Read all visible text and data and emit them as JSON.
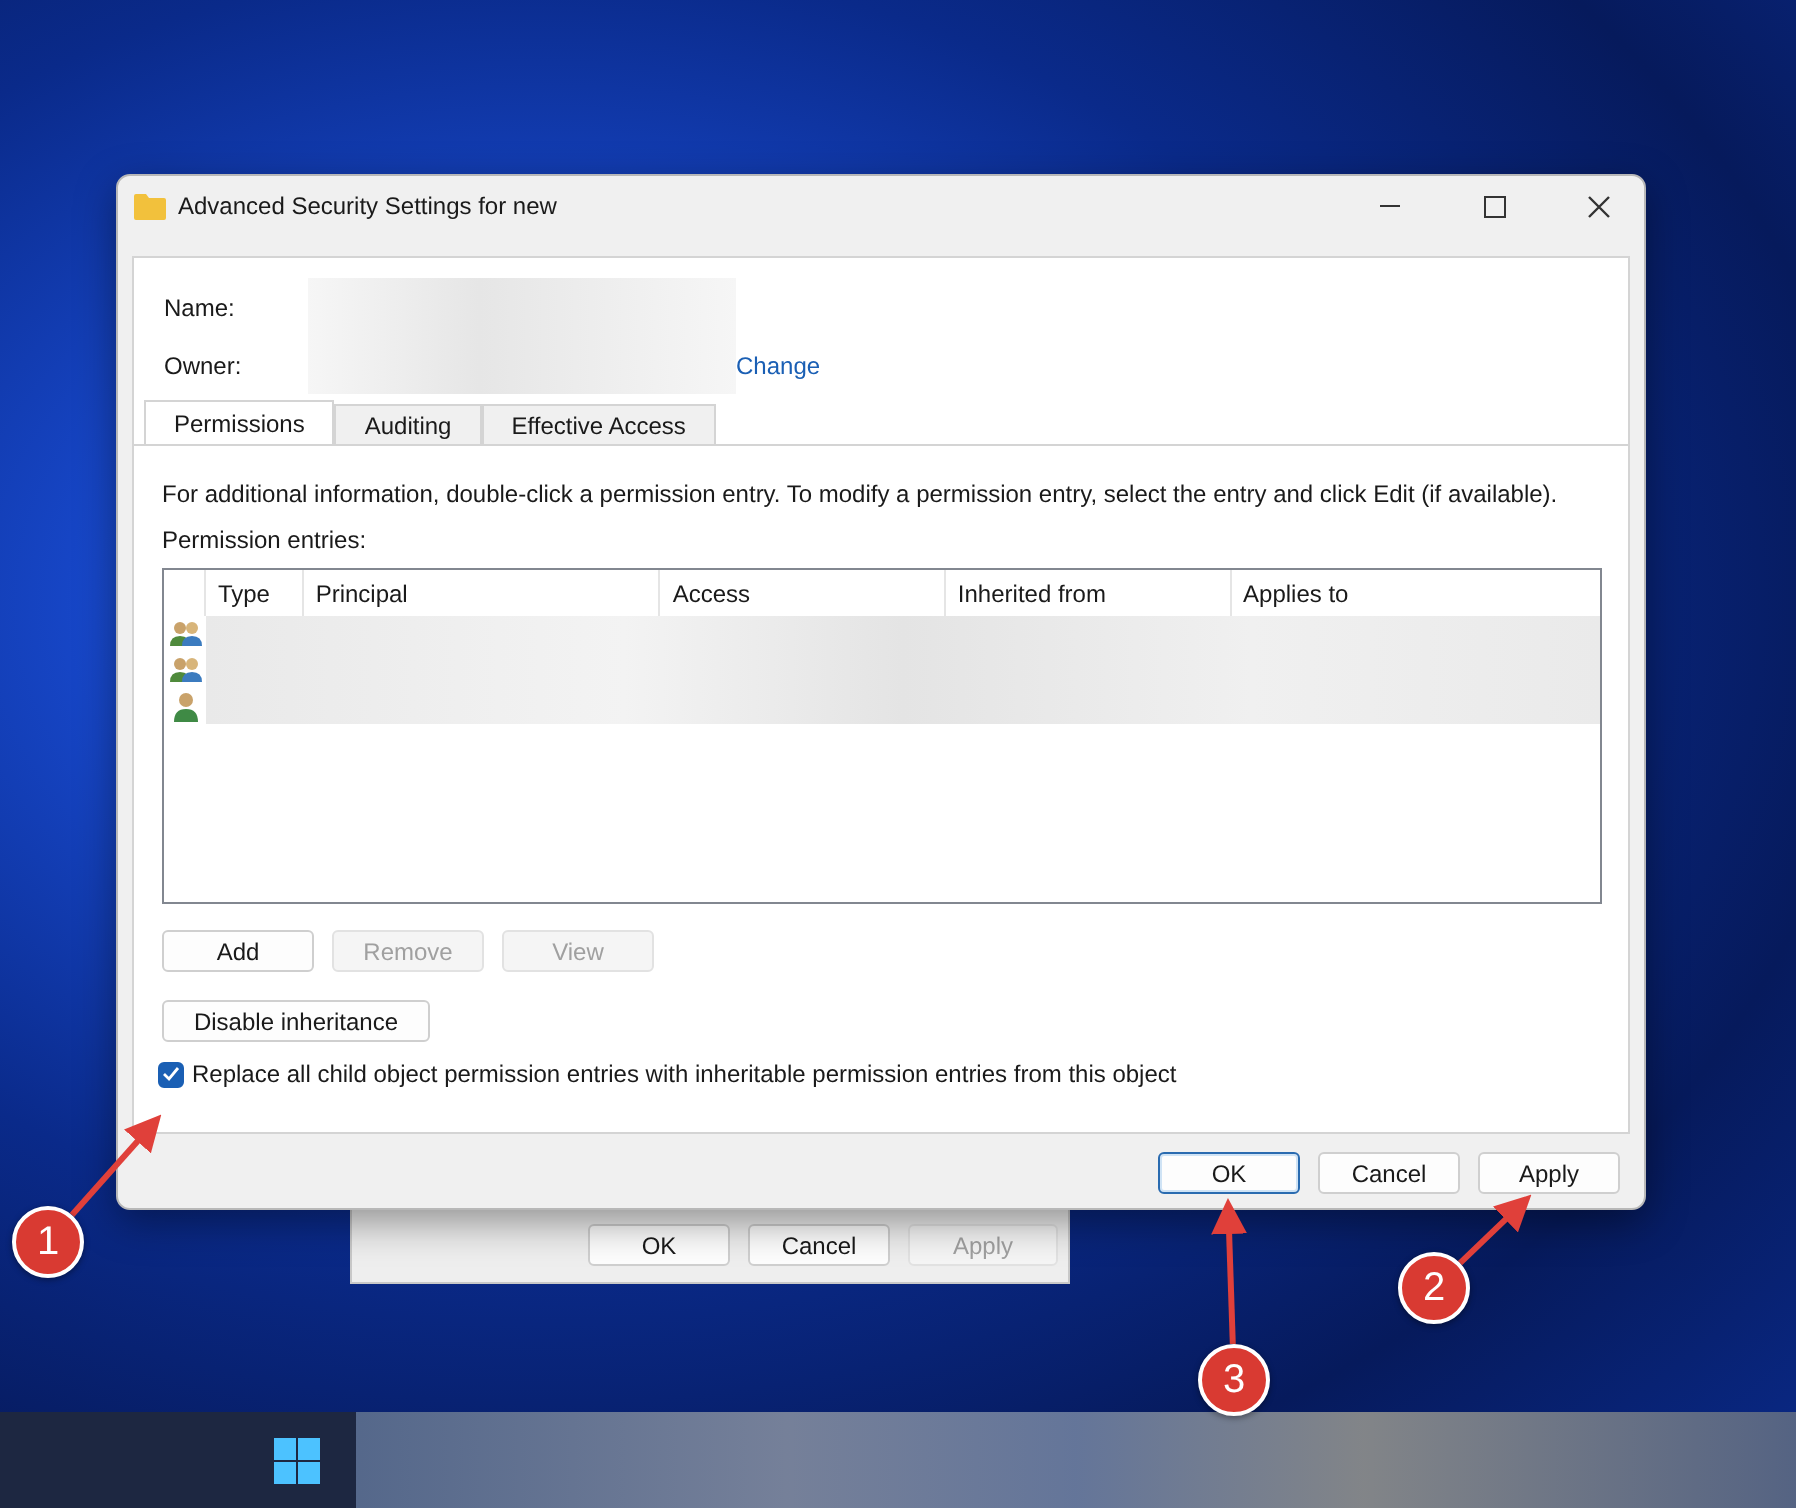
{
  "window": {
    "title": "Advanced Security Settings for new"
  },
  "name_label": "Name:",
  "owner_label": "Owner:",
  "change_link": "Change",
  "tabs": [
    {
      "label": "Permissions",
      "selected": true
    },
    {
      "label": "Auditing",
      "selected": false
    },
    {
      "label": "Effective Access",
      "selected": false
    }
  ],
  "info_text": "For additional information, double-click a permission entry. To modify a permission entry, select the entry and click Edit (if available).",
  "entries_label": "Permission entries:",
  "table": {
    "columns": [
      "Type",
      "Principal",
      "Access",
      "Inherited from",
      "Applies to"
    ],
    "rows": [
      {
        "kind": "group"
      },
      {
        "kind": "group"
      },
      {
        "kind": "user"
      }
    ]
  },
  "entry_buttons": [
    {
      "label": "Add",
      "disabled": false
    },
    {
      "label": "Remove",
      "disabled": true
    },
    {
      "label": "View",
      "disabled": true
    }
  ],
  "disable_inheritance": "Disable inheritance",
  "replace_checkbox": {
    "label": "Replace all child object permission entries with inheritable permission entries from this object",
    "checked": true
  },
  "dialog_buttons": [
    {
      "label": "OK",
      "focused": true
    },
    {
      "label": "Cancel",
      "focused": false
    },
    {
      "label": "Apply",
      "focused": false
    }
  ],
  "background_dialog": {
    "buttons": [
      {
        "label": "OK",
        "disabled": false
      },
      {
        "label": "Cancel",
        "disabled": false
      },
      {
        "label": "Apply",
        "disabled": true
      }
    ]
  },
  "annotations": [
    {
      "label": "1"
    },
    {
      "label": "2"
    },
    {
      "label": "3"
    }
  ]
}
